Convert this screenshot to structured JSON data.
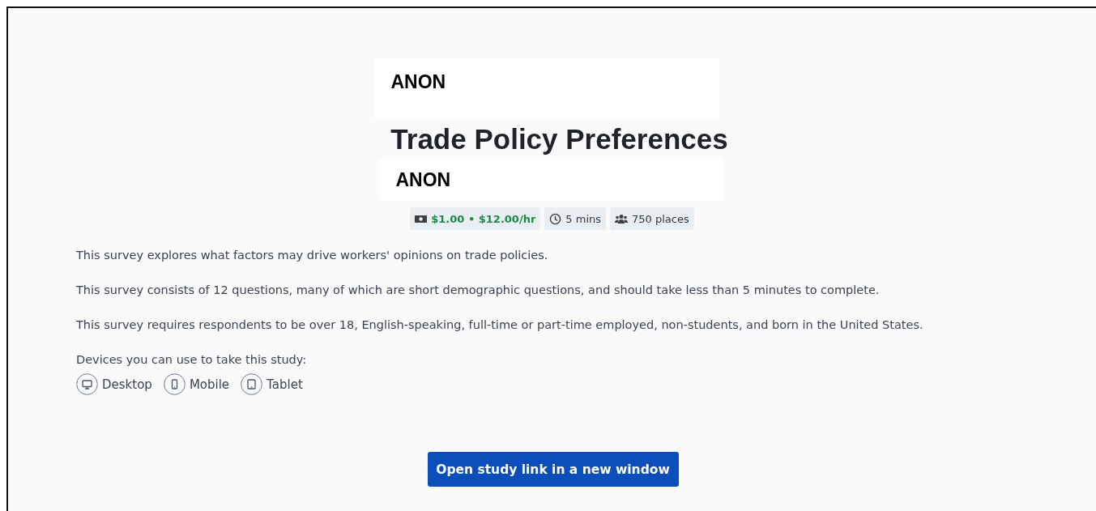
{
  "redactions": [
    "ANON",
    "ANON"
  ],
  "title": "Trade Policy Preferences",
  "badges": [
    {
      "kind": "reward",
      "text": "$1.00 • $12.00/hr"
    },
    {
      "kind": "time",
      "text": "5 mins"
    },
    {
      "kind": "places",
      "text": "750 places"
    }
  ],
  "paragraphs": [
    "This survey explores what factors may drive workers' opinions on trade policies.",
    "This survey consists of 12 questions, many of which are short demographic questions, and should take less than 5 minutes to complete.",
    "This survey requires respondents to be over 18, English-speaking, full-time or part-time employed, non-students, and born in the United States."
  ],
  "devices_label": "Devices you can use to take this study:",
  "devices": [
    {
      "kind": "desktop",
      "label": "Desktop"
    },
    {
      "kind": "mobile",
      "label": "Mobile"
    },
    {
      "kind": "tablet",
      "label": "Tablet"
    }
  ],
  "button": "Open study link in a new window"
}
